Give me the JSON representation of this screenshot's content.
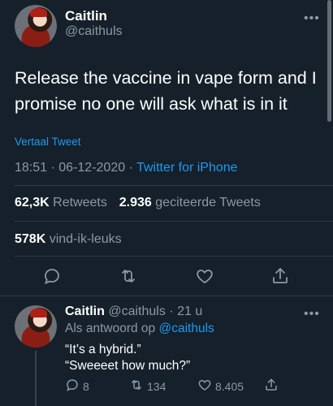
{
  "tweet": {
    "author_name": "Caitlin",
    "author_handle": "@caithuls",
    "more_label": "•••",
    "text_line1": "Release the vaccine in vape form and I",
    "text_line2": "promise no one will ask what is in it",
    "translate_label": "Vertaal Tweet",
    "time": "18:51",
    "separator1": "·",
    "date": "06-12-2020",
    "separator2": "·",
    "source": "Twitter for iPhone",
    "retweets_count": "62,3K",
    "retweets_label": "Retweets",
    "quotes_count": "2.936",
    "quotes_label": "geciteerde Tweets",
    "likes_count": "578K",
    "likes_label": "vind-ik-leuks"
  },
  "reply": {
    "author_name": "Caitlin",
    "author_handle": "@caithuls",
    "time": "· 21 u",
    "more_label": "•••",
    "reply_to_prefix": "Als antwoord op",
    "reply_to_handle": "@caithuls",
    "line1": "“It’s a hybrid.”",
    "line2": "“Sweeeet how much?”",
    "reply_count": "8",
    "retweet_count": "134",
    "like_count": "8.405"
  },
  "colors": {
    "background": "#15202b",
    "link": "#1d9bf0",
    "muted": "#8b98a5"
  }
}
